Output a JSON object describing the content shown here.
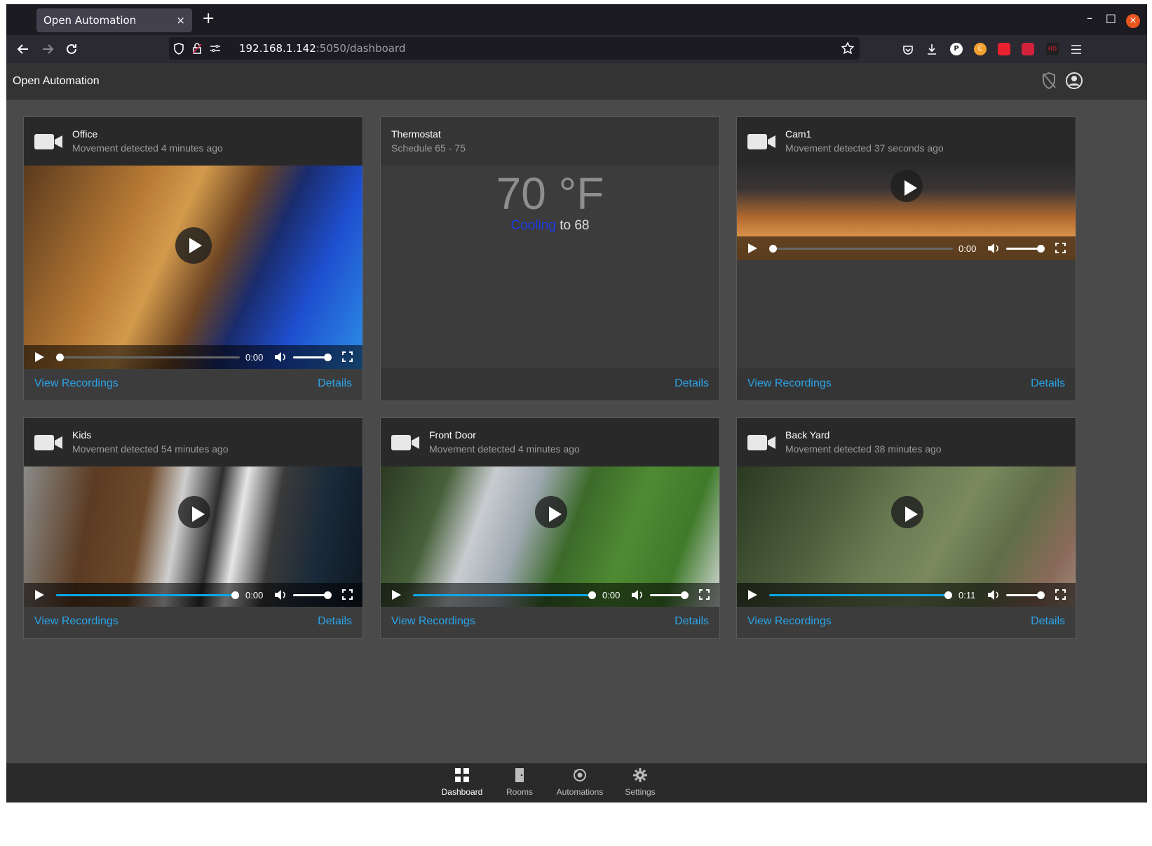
{
  "browser": {
    "tab_title": "Open Automation",
    "tab_close": "×",
    "new_tab": "+",
    "url_host": "192.168.1.142",
    "url_rest": ":5050/dashboard",
    "win_min": "–",
    "win_max": "□",
    "win_close": "×",
    "ext_p": "P",
    "ext_c": "C",
    "ext_hd": "HD"
  },
  "app": {
    "title": "Open Automation"
  },
  "cards": {
    "office": {
      "title": "Office",
      "subtitle": "Movement detected 4 minutes ago",
      "time": "0:00",
      "progress": 0.0,
      "volume": 1.0,
      "view": "View Recordings",
      "details": "Details"
    },
    "thermostat": {
      "title": "Thermostat",
      "subtitle": "Schedule 65 - 75",
      "temperature": "70 °F",
      "mode": "Cooling",
      "target": " to 68",
      "details": "Details"
    },
    "cam1": {
      "title": "Cam1",
      "subtitle": "Movement detected 37 seconds ago",
      "time": "0:00",
      "progress": 0.0,
      "volume": 1.0,
      "view": "View Recordings",
      "details": "Details"
    },
    "kids": {
      "title": "Kids",
      "subtitle": "Movement detected 54 minutes ago",
      "time": "0:00",
      "progress": 1.0,
      "volume": 1.0,
      "view": "View Recordings",
      "details": "Details"
    },
    "frontdoor": {
      "title": "Front Door",
      "subtitle": "Movement detected 4 minutes ago",
      "time": "0:00",
      "progress": 1.0,
      "volume": 1.0,
      "view": "View Recordings",
      "details": "Details"
    },
    "backyard": {
      "title": "Back Yard",
      "subtitle": "Movement detected 38 minutes ago",
      "time": "0:11",
      "progress": 1.0,
      "volume": 1.0,
      "view": "View Recordings",
      "details": "Details"
    }
  },
  "bottom_nav": {
    "dashboard": "Dashboard",
    "rooms": "Rooms",
    "automations": "Automations",
    "settings": "Settings"
  },
  "colors": {
    "link": "#2ba4e8",
    "cooling": "#1b3ee6",
    "progress": "#0aa8e8"
  }
}
